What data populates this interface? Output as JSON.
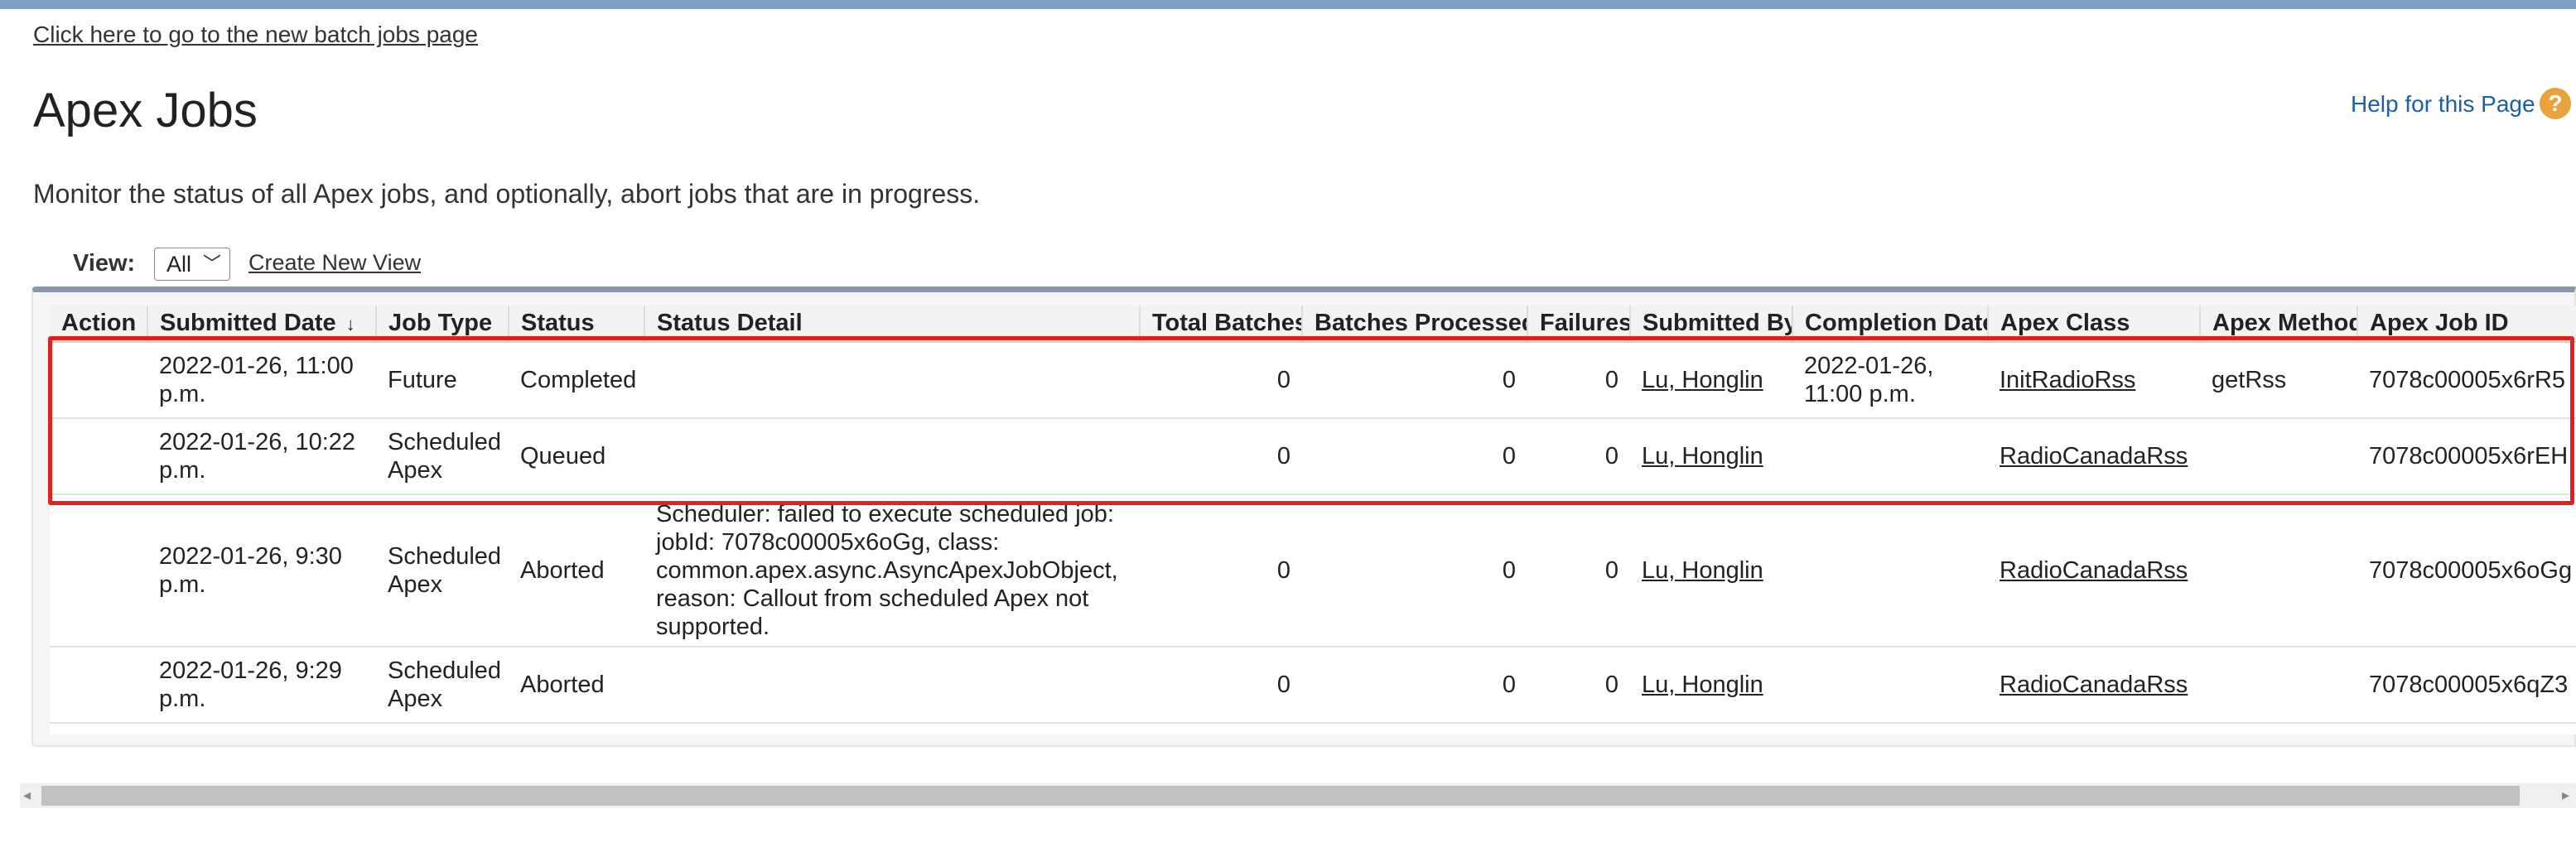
{
  "batch_link": "Click here to go to the new batch jobs page",
  "page": {
    "title": "Apex Jobs",
    "help": "Help for this Page",
    "help_icon": "?",
    "description": "Monitor the status of all Apex jobs, and optionally, abort jobs that are in progress."
  },
  "view": {
    "label": "View:",
    "selected": "All",
    "create_new": "Create New View"
  },
  "table": {
    "headers": [
      "Action",
      "Submitted Date",
      "Job Type",
      "Status",
      "Status Detail",
      "Total Batches",
      "Batches Processed",
      "Failures",
      "Submitted By",
      "Completion Date",
      "Apex Class",
      "Apex Method",
      "Apex Job ID"
    ],
    "sort_indicator": "↓",
    "rows": [
      {
        "action": "",
        "submitted": "2022-01-26, 11:00 p.m.",
        "job_type": "Future",
        "status": "Completed",
        "detail": "",
        "total": "0",
        "processed": "0",
        "failures": "0",
        "submitted_by": "Lu, Honglin",
        "completion": "2022-01-26, 11:00 p.m.",
        "apex_class": "InitRadioRss",
        "apex_method": "getRss",
        "job_id": "7078c00005x6rR5"
      },
      {
        "action": "",
        "submitted": "2022-01-26, 10:22 p.m.",
        "job_type": "Scheduled Apex",
        "status": "Queued",
        "detail": "",
        "total": "0",
        "processed": "0",
        "failures": "0",
        "submitted_by": "Lu, Honglin",
        "completion": "",
        "apex_class": "RadioCanadaRss",
        "apex_method": "",
        "job_id": "7078c00005x6rEH"
      },
      {
        "action": "",
        "submitted": "2022-01-26, 9:30 p.m.",
        "job_type": "Scheduled Apex",
        "status": "Aborted",
        "detail": "Scheduler: failed to execute scheduled job: jobId: 7078c00005x6oGg, class: common.apex.async.AsyncApexJobObject, reason: Callout from scheduled Apex not supported.",
        "total": "0",
        "processed": "0",
        "failures": "0",
        "submitted_by": "Lu, Honglin",
        "completion": "",
        "apex_class": "RadioCanadaRss",
        "apex_method": "",
        "job_id": "7078c00005x6oGg"
      },
      {
        "action": "",
        "submitted": "2022-01-26, 9:29 p.m.",
        "job_type": "Scheduled Apex",
        "status": "Aborted",
        "detail": "",
        "total": "0",
        "processed": "0",
        "failures": "0",
        "submitted_by": "Lu, Honglin",
        "completion": "",
        "apex_class": "RadioCanadaRss",
        "apex_method": "",
        "job_id": "7078c00005x6qZ3"
      }
    ]
  },
  "scroll": {
    "left_arrow": "◂",
    "right_arrow": "▸"
  },
  "colors": {
    "accent_link": "#1a5fa8",
    "highlight_border": "#e32020",
    "header_band": "#7f9ec4",
    "help_icon": "#e8a33a"
  }
}
